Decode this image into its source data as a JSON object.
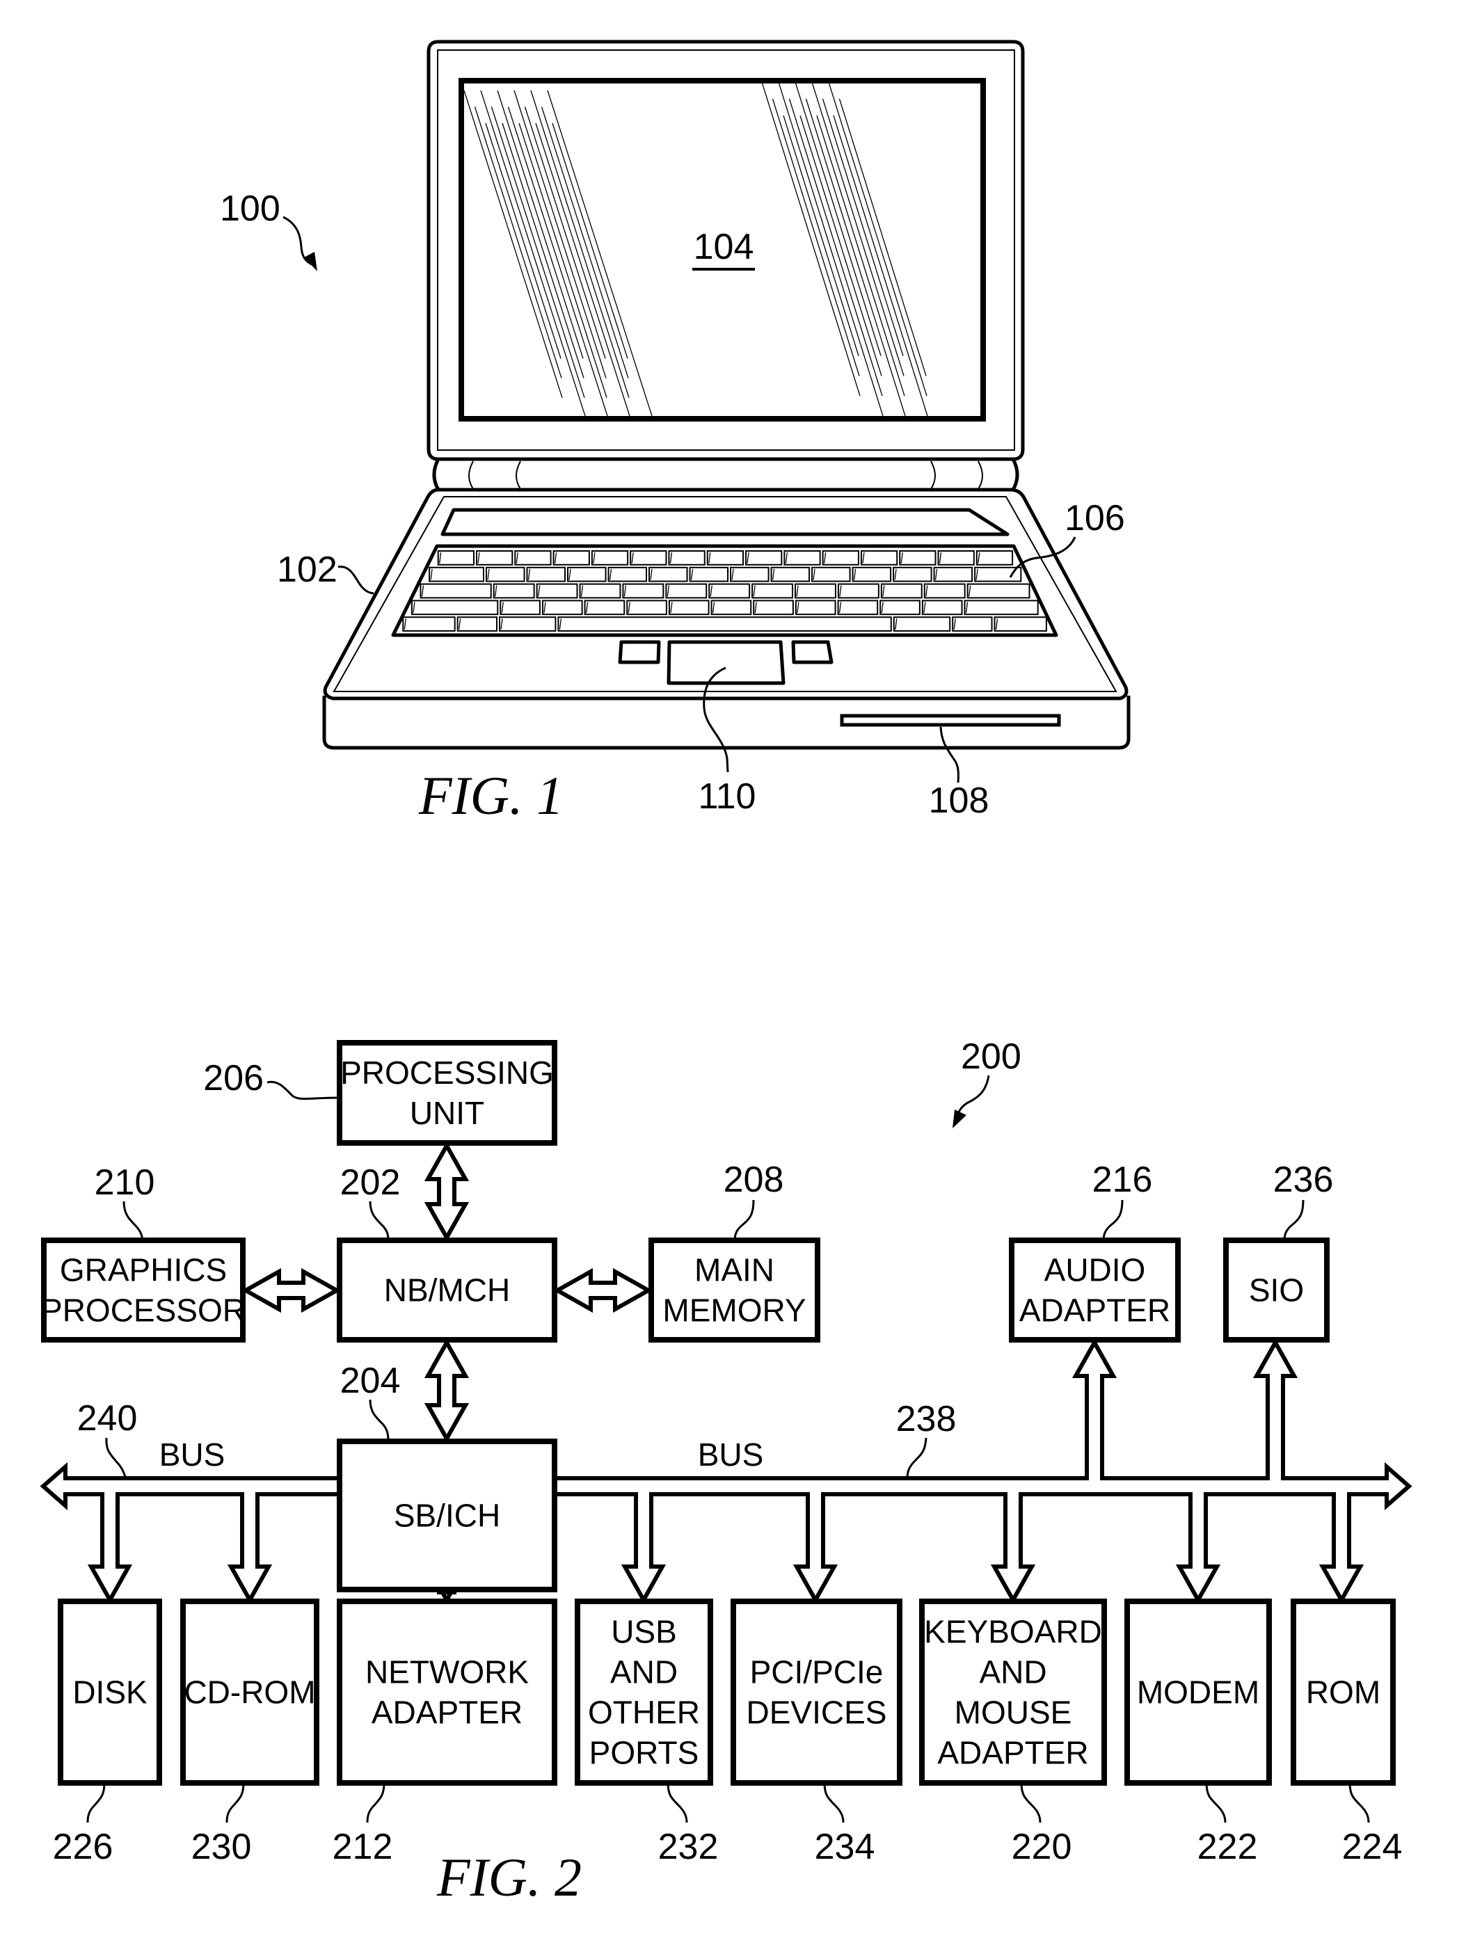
{
  "figure1": {
    "caption": "FIG. 1",
    "refs": {
      "system": "100",
      "computer": "102",
      "display": "104",
      "keyboard": "106",
      "storage": "108",
      "pointing_device": "110"
    }
  },
  "figure2": {
    "caption": "FIG. 2",
    "system_ref": "200",
    "bus_left": {
      "label": "BUS",
      "ref": "240"
    },
    "bus_right": {
      "label": "BUS",
      "ref": "238"
    },
    "blocks": {
      "processing_unit": {
        "lines": [
          "PROCESSING",
          "UNIT"
        ],
        "ref": "206"
      },
      "nb_mch": {
        "lines": [
          "NB/MCH"
        ],
        "ref": "202"
      },
      "graphics_processor": {
        "lines": [
          "GRAPHICS",
          "PROCESSOR"
        ],
        "ref": "210"
      },
      "main_memory": {
        "lines": [
          "MAIN",
          "MEMORY"
        ],
        "ref": "208"
      },
      "audio_adapter": {
        "lines": [
          "AUDIO",
          "ADAPTER"
        ],
        "ref": "216"
      },
      "sio": {
        "lines": [
          "SIO"
        ],
        "ref": "236"
      },
      "sb_ich": {
        "lines": [
          "SB/ICH"
        ],
        "ref": "204"
      },
      "disk": {
        "lines": [
          "DISK"
        ],
        "ref": "226"
      },
      "cd_rom": {
        "lines": [
          "CD-ROM"
        ],
        "ref": "230"
      },
      "network_adapter": {
        "lines": [
          "NETWORK",
          "ADAPTER"
        ],
        "ref": "212"
      },
      "usb_ports": {
        "lines": [
          "USB",
          "AND",
          "OTHER",
          "PORTS"
        ],
        "ref": "232"
      },
      "pci_devices": {
        "lines": [
          "PCI/PCIe",
          "DEVICES"
        ],
        "ref": "234"
      },
      "keyboard_mouse_adapter": {
        "lines": [
          "KEYBOARD",
          "AND",
          "MOUSE",
          "ADAPTER"
        ],
        "ref": "220"
      },
      "modem": {
        "lines": [
          "MODEM"
        ],
        "ref": "222"
      },
      "rom": {
        "lines": [
          "ROM"
        ],
        "ref": "224"
      }
    }
  }
}
